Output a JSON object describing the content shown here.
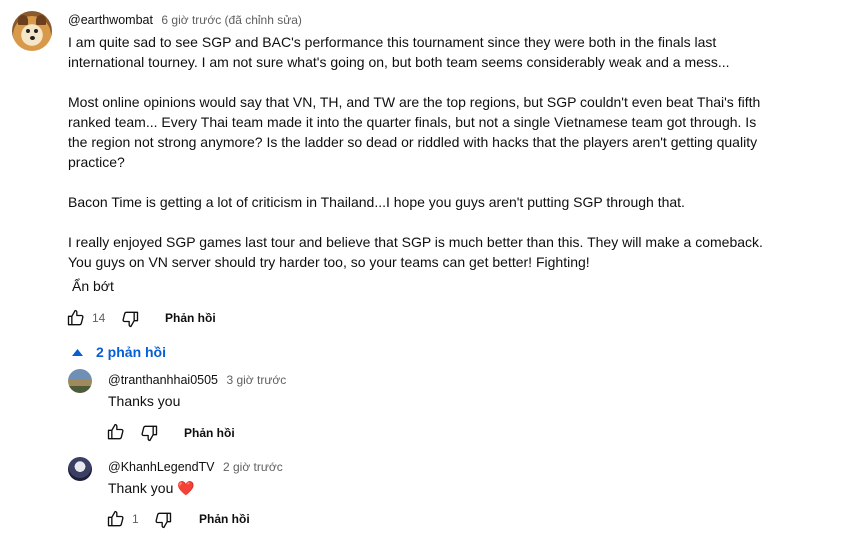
{
  "comment": {
    "author": "@earthwombat",
    "meta": "6 giờ trước (đã chỉnh sửa)",
    "paragraphs": [
      "I am quite sad to see SGP and BAC's performance this tournament since they were both in the finals last international tourney. I am not sure what's going on, but both team seems considerably weak and a mess...",
      "Most online opinions would say that VN, TH, and TW are the top regions, but SGP couldn't even beat Thai's fifth ranked team... Every Thai team made it into the quarter finals, but not a single Vietnamese team got through. Is the region not strong anymore? Is the ladder so dead or riddled with hacks that the players aren't getting quality practice?",
      "Bacon Time is getting a lot of criticism in Thailand...I hope you guys aren't putting SGP through that.",
      "I really enjoyed SGP games last tour and believe that SGP is much better than this. They will make a comeback. You guys on VN server should try harder too, so your teams can get better! Fighting!"
    ],
    "show_less": "Ẩn bớt",
    "likes": "14",
    "reply_label": "Phản hồi"
  },
  "replies_toggle": "2 phản hồi",
  "replies": [
    {
      "author": "@tranthanhhai0505",
      "meta": "3 giờ trước",
      "text": "Thanks you",
      "likes": "",
      "reply_label": "Phản hồi"
    },
    {
      "author": "@KhanhLegendTV",
      "meta": "2 giờ trước",
      "text": "Thank you",
      "emoji": "❤️",
      "likes": "1",
      "reply_label": "Phản hồi"
    }
  ],
  "icons": {
    "like": "thumb-up-icon",
    "dislike": "thumb-down-icon",
    "collapse": "caret-up-icon"
  },
  "colors": {
    "link_blue": "#065fd4",
    "meta_gray": "#606060",
    "heart_red": "#e0245e"
  }
}
